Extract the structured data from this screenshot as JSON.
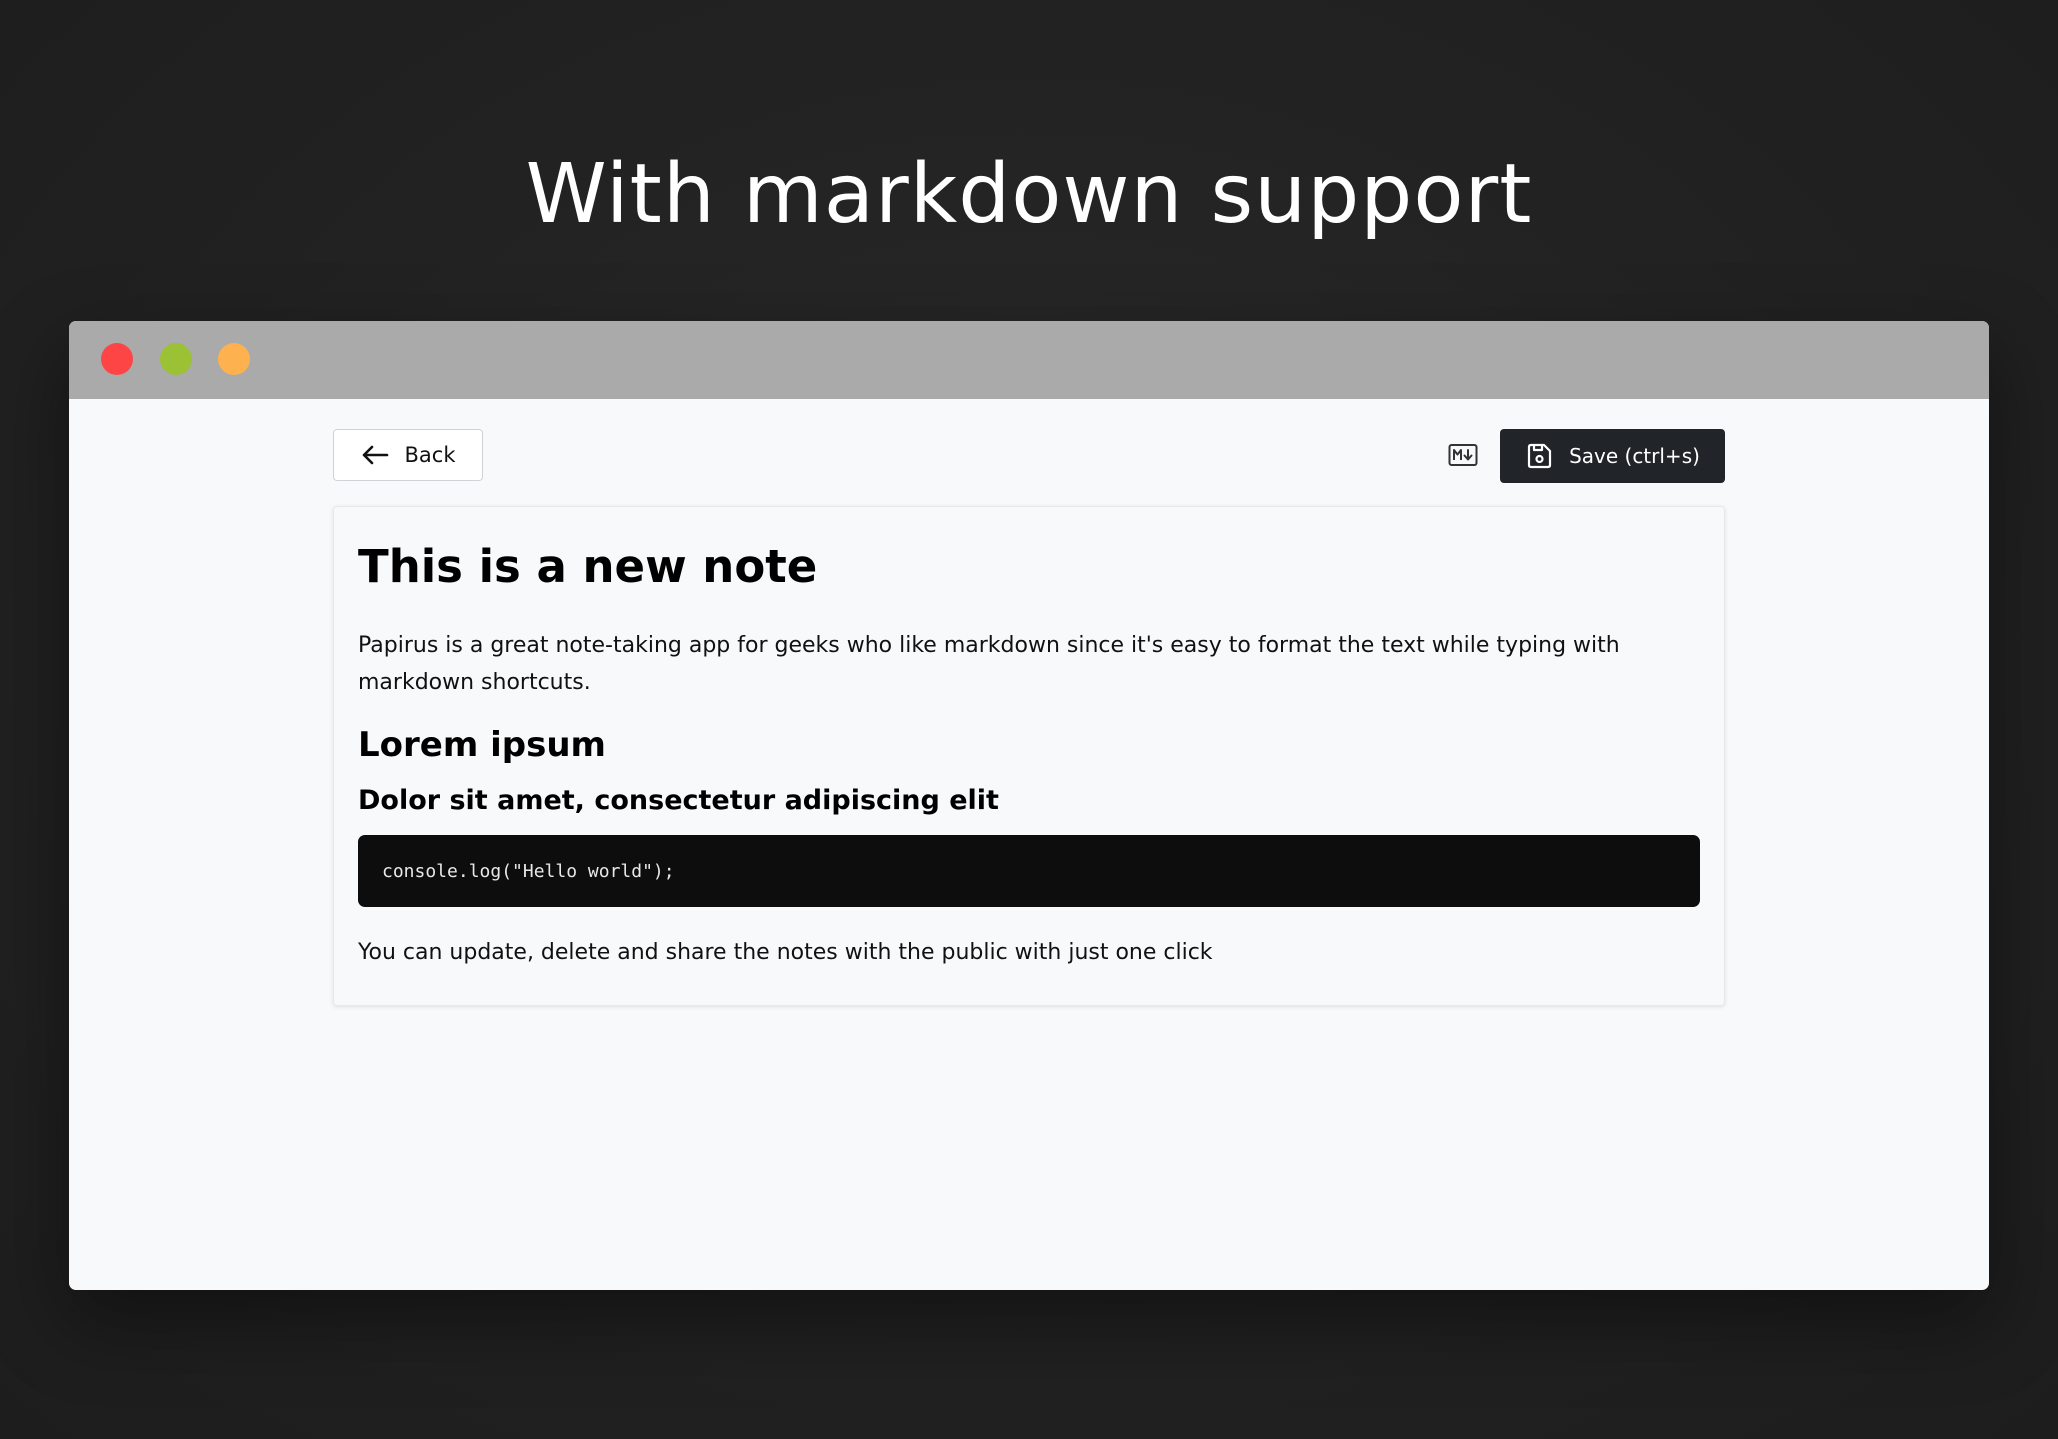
{
  "headline": "With markdown support",
  "window": {
    "traffic_lights": [
      {
        "name": "close",
        "color": "#fd4545"
      },
      {
        "name": "minimize",
        "color": "#9bc134"
      },
      {
        "name": "zoom",
        "color": "#fdb24f"
      }
    ],
    "titlebar_color": "#aaaaaa"
  },
  "toolbar": {
    "back_label": "Back",
    "back_icon": "arrow-left-icon",
    "markdown_toggle_icon": "markdown-icon",
    "save_label": "Save (ctrl+s)",
    "save_icon": "floppy-disk-icon"
  },
  "note": {
    "title": "This is a new note",
    "paragraph": "Papirus is a great note-taking app for geeks who like markdown since it's easy to format the text while typing with markdown shortcuts.",
    "heading2": "Lorem ipsum",
    "heading3": "Dolor sit amet, consectetur adipiscing elit",
    "code": "console.log(\"Hello world\");",
    "closing": "You can update, delete and share the notes with the public with just one click"
  },
  "colors": {
    "background": "#232323",
    "surface": "#f8f9fa",
    "primary_button": "#212529",
    "code_background": "#0d0d0d"
  }
}
